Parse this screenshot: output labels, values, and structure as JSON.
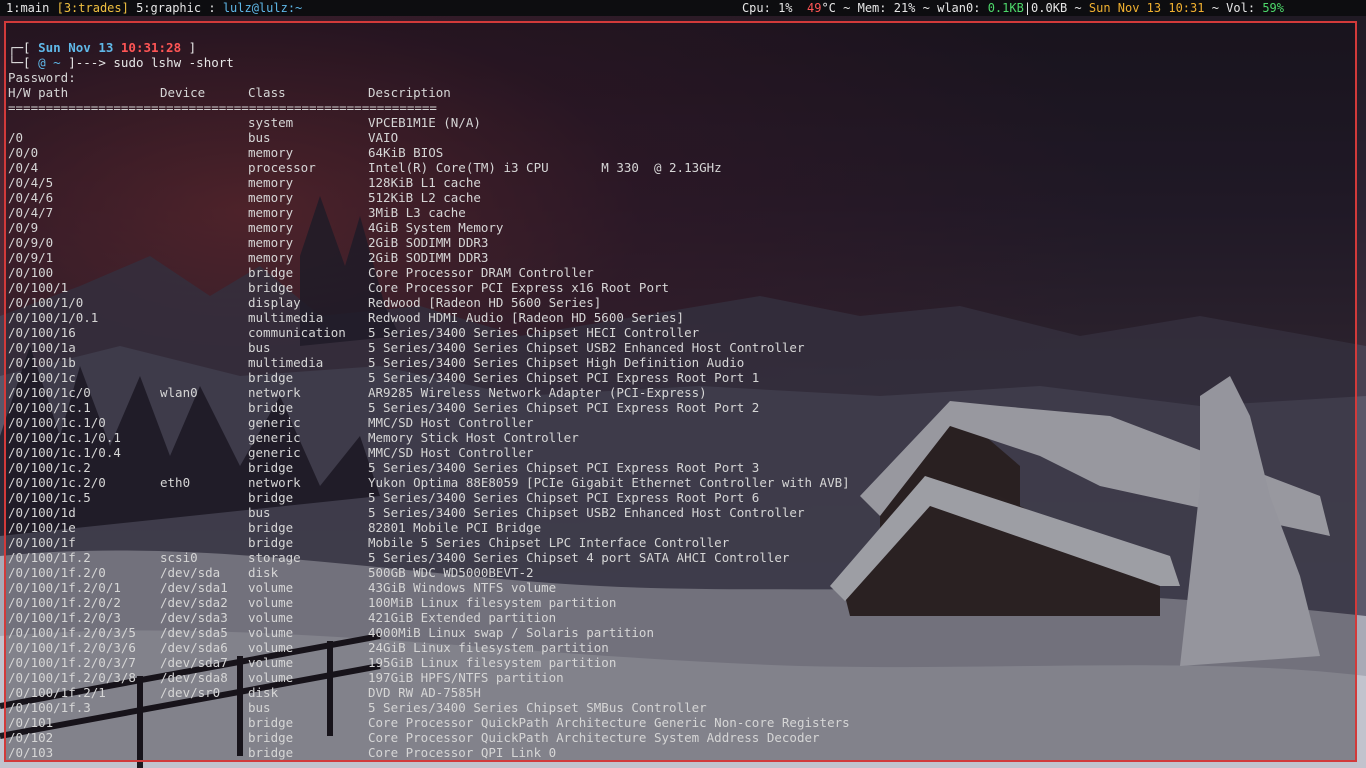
{
  "statusbar": {
    "tags": [
      {
        "label": "1:main",
        "active": false
      },
      {
        "label": "[3:trades]",
        "active": true
      },
      {
        "label": "5:graphic",
        "active": false
      }
    ],
    "separator": ":",
    "window_title": "lulz@lulz:~",
    "cpu_label": "Cpu: 1%",
    "temp_value": "49",
    "temp_unit": "°C",
    "tilde1": "~",
    "mem_label": "Mem: 21%",
    "tilde2": "~",
    "net_label": "wlan0:",
    "net_down": "0.1KB",
    "net_sep": "|",
    "net_up": "0.0KB",
    "tilde3": "~",
    "datetime": "Sun Nov 13 10:31",
    "tilde4": "~",
    "vol_label": "Vol:",
    "vol_value": "59%"
  },
  "terminal": {
    "prompt": {
      "line1_open": "┌─[",
      "date": "Sun Nov 13",
      "time": "10:31:28",
      "line1_close": "]",
      "line2_open": "└─[",
      "dir": "@ ~",
      "line2_arrow": "]--->",
      "command": "sudo lshw -short"
    },
    "password_line": "Password:",
    "headers": [
      "H/W path",
      "Device",
      "Class",
      "Description"
    ],
    "rule": "=========================================================",
    "rows": [
      [
        "",
        "",
        "system",
        "VPCEB1M1E (N/A)"
      ],
      [
        "/0",
        "",
        "bus",
        "VAIO"
      ],
      [
        "/0/0",
        "",
        "memory",
        "64KiB BIOS"
      ],
      [
        "/0/4",
        "",
        "processor",
        "Intel(R) Core(TM) i3 CPU       M 330  @ 2.13GHz"
      ],
      [
        "/0/4/5",
        "",
        "memory",
        "128KiB L1 cache"
      ],
      [
        "/0/4/6",
        "",
        "memory",
        "512KiB L2 cache"
      ],
      [
        "/0/4/7",
        "",
        "memory",
        "3MiB L3 cache"
      ],
      [
        "/0/9",
        "",
        "memory",
        "4GiB System Memory"
      ],
      [
        "/0/9/0",
        "",
        "memory",
        "2GiB SODIMM DDR3"
      ],
      [
        "/0/9/1",
        "",
        "memory",
        "2GiB SODIMM DDR3"
      ],
      [
        "/0/100",
        "",
        "bridge",
        "Core Processor DRAM Controller"
      ],
      [
        "/0/100/1",
        "",
        "bridge",
        "Core Processor PCI Express x16 Root Port"
      ],
      [
        "/0/100/1/0",
        "",
        "display",
        "Redwood [Radeon HD 5600 Series]"
      ],
      [
        "/0/100/1/0.1",
        "",
        "multimedia",
        "Redwood HDMI Audio [Radeon HD 5600 Series]"
      ],
      [
        "/0/100/16",
        "",
        "communication",
        "5 Series/3400 Series Chipset HECI Controller"
      ],
      [
        "/0/100/1a",
        "",
        "bus",
        "5 Series/3400 Series Chipset USB2 Enhanced Host Controller"
      ],
      [
        "/0/100/1b",
        "",
        "multimedia",
        "5 Series/3400 Series Chipset High Definition Audio"
      ],
      [
        "/0/100/1c",
        "",
        "bridge",
        "5 Series/3400 Series Chipset PCI Express Root Port 1"
      ],
      [
        "/0/100/1c/0",
        "wlan0",
        "network",
        "AR9285 Wireless Network Adapter (PCI-Express)"
      ],
      [
        "/0/100/1c.1",
        "",
        "bridge",
        "5 Series/3400 Series Chipset PCI Express Root Port 2"
      ],
      [
        "/0/100/1c.1/0",
        "",
        "generic",
        "MMC/SD Host Controller"
      ],
      [
        "/0/100/1c.1/0.1",
        "",
        "generic",
        "Memory Stick Host Controller"
      ],
      [
        "/0/100/1c.1/0.4",
        "",
        "generic",
        "MMC/SD Host Controller"
      ],
      [
        "/0/100/1c.2",
        "",
        "bridge",
        "5 Series/3400 Series Chipset PCI Express Root Port 3"
      ],
      [
        "/0/100/1c.2/0",
        "eth0",
        "network",
        "Yukon Optima 88E8059 [PCIe Gigabit Ethernet Controller with AVB]"
      ],
      [
        "/0/100/1c.5",
        "",
        "bridge",
        "5 Series/3400 Series Chipset PCI Express Root Port 6"
      ],
      [
        "/0/100/1d",
        "",
        "bus",
        "5 Series/3400 Series Chipset USB2 Enhanced Host Controller"
      ],
      [
        "/0/100/1e",
        "",
        "bridge",
        "82801 Mobile PCI Bridge"
      ],
      [
        "/0/100/1f",
        "",
        "bridge",
        "Mobile 5 Series Chipset LPC Interface Controller"
      ],
      [
        "/0/100/1f.2",
        "scsi0",
        "storage",
        "5 Series/3400 Series Chipset 4 port SATA AHCI Controller"
      ],
      [
        "/0/100/1f.2/0",
        "/dev/sda",
        "disk",
        "500GB WDC WD5000BEVT-2"
      ],
      [
        "/0/100/1f.2/0/1",
        "/dev/sda1",
        "volume",
        "43GiB Windows NTFS volume"
      ],
      [
        "/0/100/1f.2/0/2",
        "/dev/sda2",
        "volume",
        "100MiB Linux filesystem partition"
      ],
      [
        "/0/100/1f.2/0/3",
        "/dev/sda3",
        "volume",
        "421GiB Extended partition"
      ],
      [
        "/0/100/1f.2/0/3/5",
        "/dev/sda5",
        "volume",
        "4000MiB Linux swap / Solaris partition"
      ],
      [
        "/0/100/1f.2/0/3/6",
        "/dev/sda6",
        "volume",
        "24GiB Linux filesystem partition"
      ],
      [
        "/0/100/1f.2/0/3/7",
        "/dev/sda7",
        "volume",
        "195GiB Linux filesystem partition"
      ],
      [
        "/0/100/1f.2/0/3/8",
        "/dev/sda8",
        "volume",
        "197GiB HPFS/NTFS partition"
      ],
      [
        "/0/100/1f.2/1",
        "/dev/sr0",
        "disk",
        "DVD RW AD-7585H"
      ],
      [
        "/0/100/1f.3",
        "",
        "bus",
        "5 Series/3400 Series Chipset SMBus Controller"
      ],
      [
        "/0/101",
        "",
        "bridge",
        "Core Processor QuickPath Architecture Generic Non-core Registers"
      ],
      [
        "/0/102",
        "",
        "bridge",
        "Core Processor QuickPath Architecture System Address Decoder"
      ],
      [
        "/0/103",
        "",
        "bridge",
        "Core Processor QPI Link 0"
      ]
    ]
  }
}
